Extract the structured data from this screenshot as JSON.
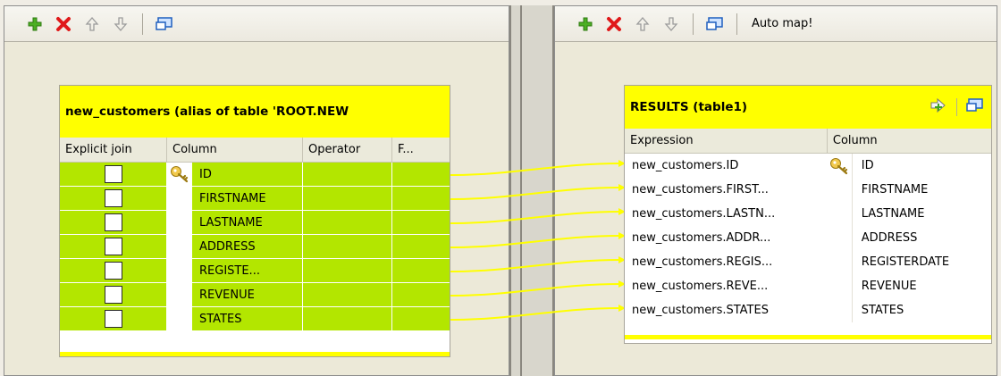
{
  "left": {
    "toolbar": {
      "icons": [
        "add-icon",
        "remove-icon",
        "move-up-icon",
        "move-down-icon",
        "window-icon"
      ]
    },
    "table": {
      "title": "new_customers  (alias of table 'ROOT.NEW",
      "headers": {
        "explicit_join": "Explicit join",
        "column": "Column",
        "operator": "Operator",
        "f": "F..."
      },
      "rows": [
        "ID",
        "FIRSTNAME",
        "LASTNAME",
        "ADDRESS",
        "REGISTE...",
        "REVENUE",
        "STATES"
      ],
      "key_row": 0
    }
  },
  "right": {
    "toolbar": {
      "auto_map": "Auto map!"
    },
    "table": {
      "title": "RESULTS (table1)",
      "headers": {
        "expression": "Expression",
        "column": "Column"
      },
      "rows": [
        {
          "expression": "new_customers.ID",
          "column": "ID"
        },
        {
          "expression": "new_customers.FIRST...",
          "column": "FIRSTNAME"
        },
        {
          "expression": "new_customers.LASTN...",
          "column": "LASTNAME"
        },
        {
          "expression": "new_customers.ADDR...",
          "column": "ADDRESS"
        },
        {
          "expression": "new_customers.REGIS...",
          "column": "REGISTERDATE"
        },
        {
          "expression": "new_customers.REVE...",
          "column": "REVENUE"
        },
        {
          "expression": "new_customers.STATES",
          "column": "STATES"
        }
      ]
    }
  },
  "colors": {
    "row_green": "#b3e600",
    "title_yellow": "#ffff00",
    "link_yellow": "#ffff00"
  }
}
